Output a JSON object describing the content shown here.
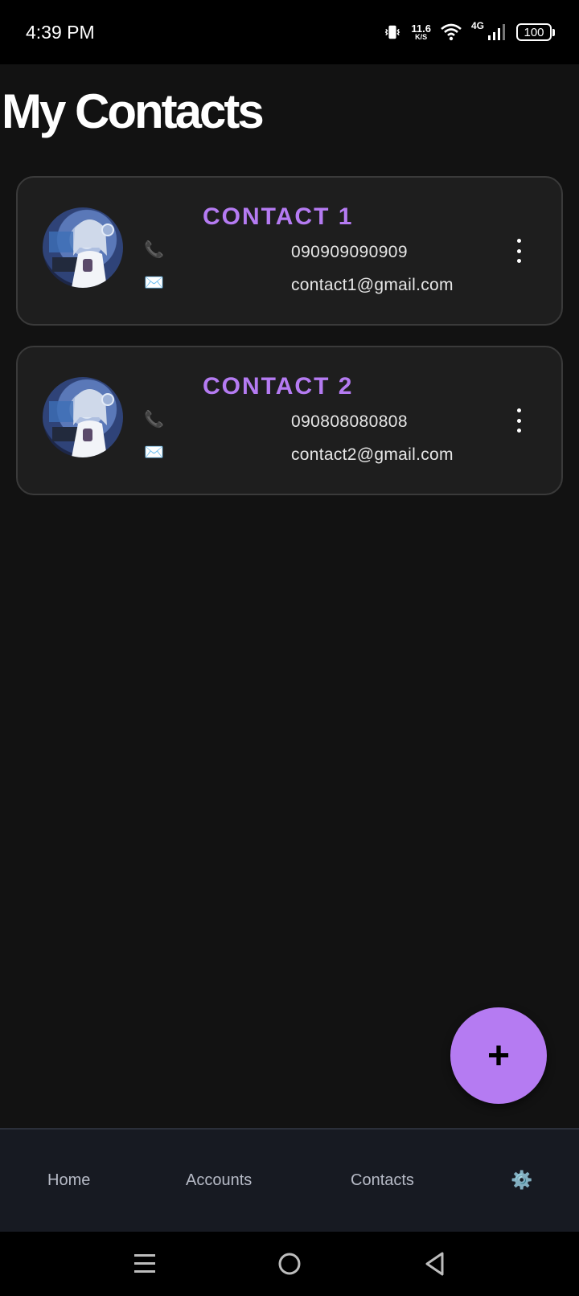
{
  "status_bar": {
    "time": "4:39 PM",
    "net_speed_value": "11.6",
    "net_speed_unit": "K/S",
    "network_type": "4G",
    "battery": "100",
    "icons": [
      "vibrate-icon",
      "wifi-icon",
      "signal-icon",
      "battery-icon"
    ]
  },
  "page": {
    "title": "My Contacts"
  },
  "contacts": [
    {
      "name": "CONTACT 1",
      "phone": "090909090909",
      "email": "contact1@gmail.com"
    },
    {
      "name": "CONTACT 2",
      "phone": "090808080808",
      "email": "contact2@gmail.com"
    }
  ],
  "icons": {
    "phone": "📞",
    "email": "✉️",
    "add": "+",
    "settings": "⚙️"
  },
  "bottom_nav": {
    "home": "Home",
    "accounts": "Accounts",
    "contacts": "Contacts"
  },
  "colors": {
    "accent": "#b57bf2",
    "background": "#121212",
    "card": "#1e1e1e",
    "nav_background": "#171a22"
  }
}
